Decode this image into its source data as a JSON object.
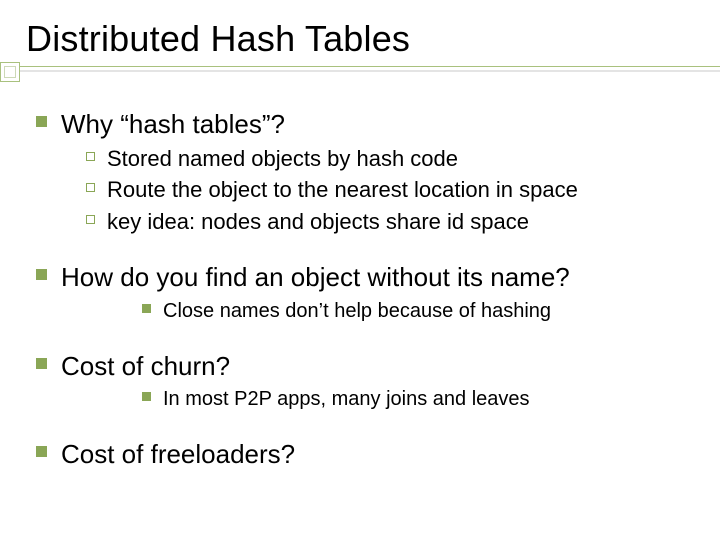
{
  "title": "Distributed Hash Tables",
  "bullets": {
    "b1": "Why “hash tables”?",
    "b1_1": "Stored named objects by hash code",
    "b1_2": "Route the object to the nearest location in space",
    "b1_3": "key idea: nodes and objects share id space",
    "b2": "How do you find an object without its name?",
    "b2_1": "Close names don’t help because of hashing",
    "b3": "Cost of churn?",
    "b3_1": "In most P2P apps, many joins and leaves",
    "b4": "Cost of freeloaders?"
  }
}
